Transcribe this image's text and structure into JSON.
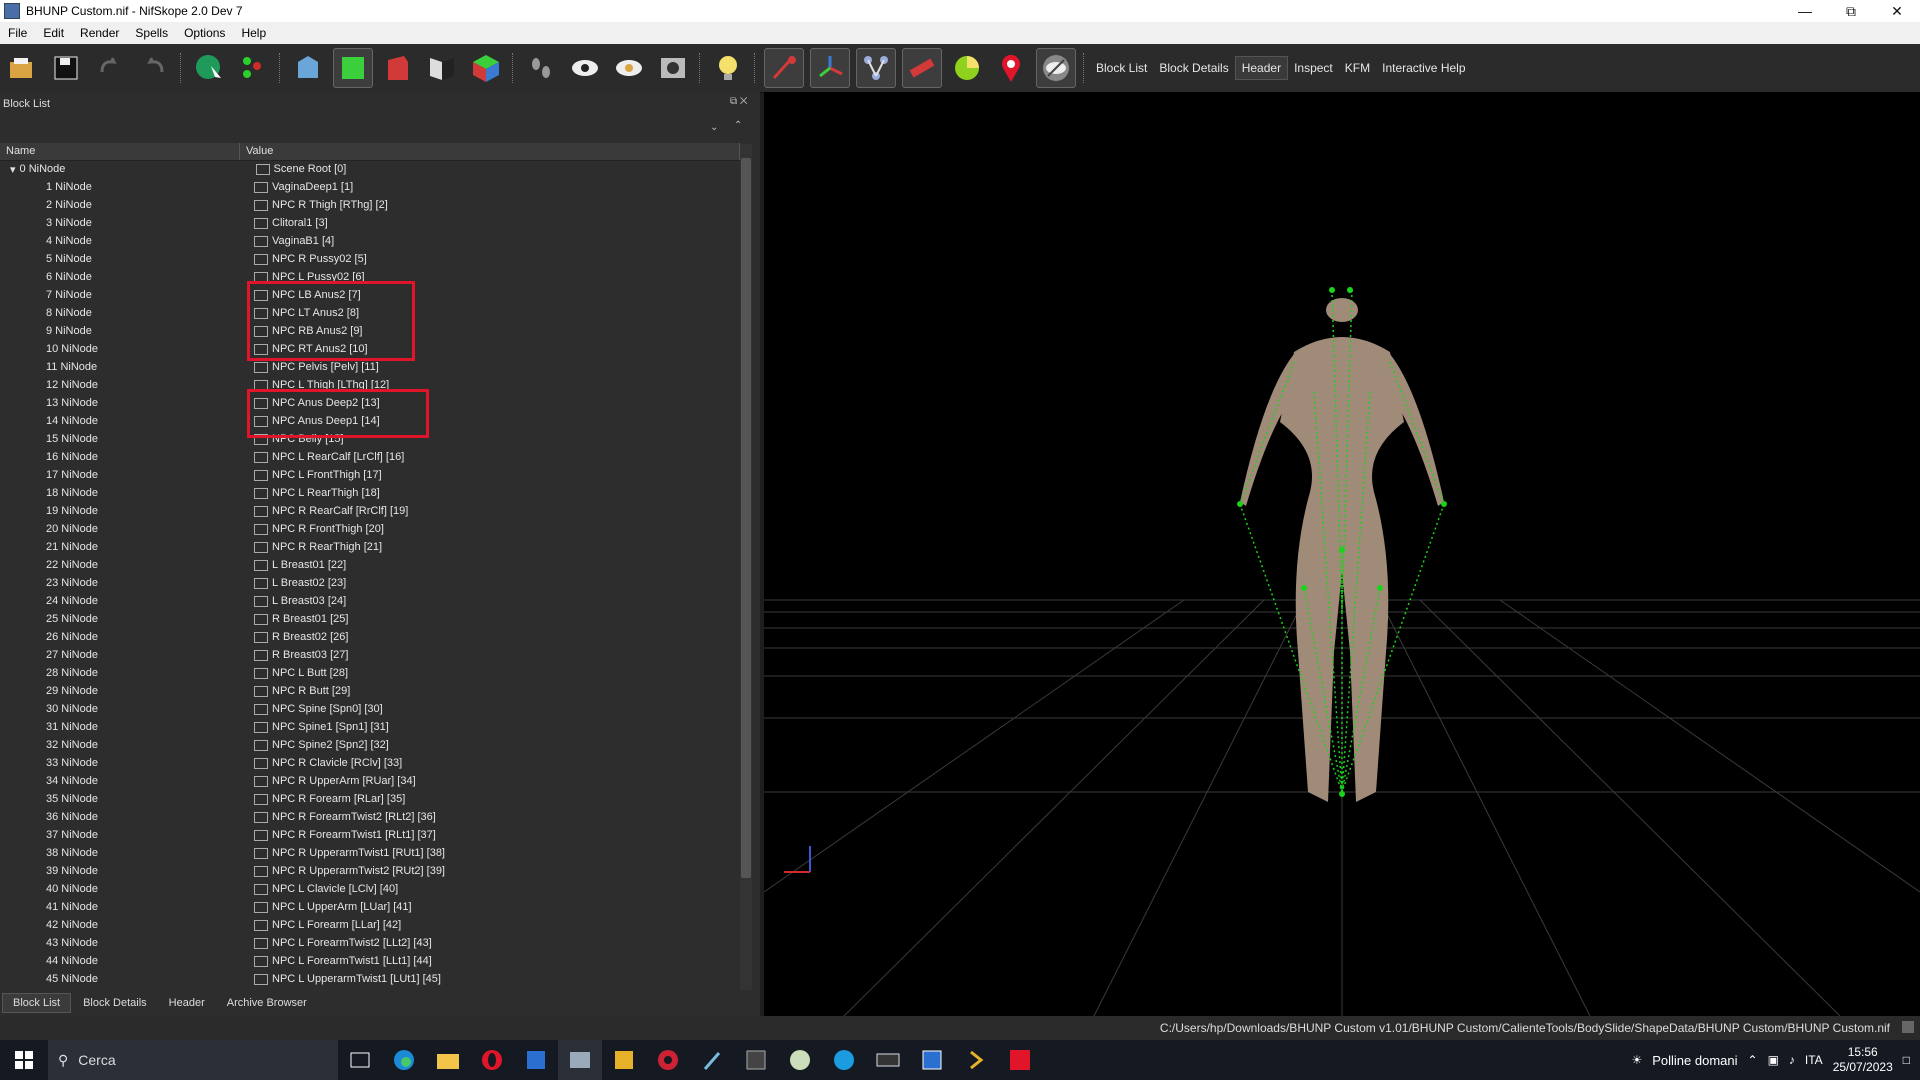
{
  "window": {
    "title": "BHUNP Custom.nif - NifSkope 2.0 Dev 7"
  },
  "menu": [
    "File",
    "Edit",
    "Render",
    "Spells",
    "Options",
    "Help"
  ],
  "toolbar": {
    "text_buttons": [
      "Block List",
      "Block Details",
      "Header",
      "Inspect",
      "KFM",
      "Interactive Help"
    ],
    "active_text_button": "Header"
  },
  "panel": {
    "title": "Block List",
    "columns": {
      "name": "Name",
      "value": "Value"
    },
    "rows": [
      {
        "name": "0 NiNode",
        "value": "Scene Root [0]"
      },
      {
        "name": "1 NiNode",
        "value": "VaginaDeep1 [1]"
      },
      {
        "name": "2 NiNode",
        "value": "NPC R Thigh [RThg] [2]"
      },
      {
        "name": "3 NiNode",
        "value": "Clitoral1 [3]"
      },
      {
        "name": "4 NiNode",
        "value": "VaginaB1 [4]"
      },
      {
        "name": "5 NiNode",
        "value": "NPC R Pussy02 [5]"
      },
      {
        "name": "6 NiNode",
        "value": "NPC L Pussy02 [6]"
      },
      {
        "name": "7 NiNode",
        "value": "NPC LB Anus2 [7]"
      },
      {
        "name": "8 NiNode",
        "value": "NPC LT Anus2 [8]"
      },
      {
        "name": "9 NiNode",
        "value": "NPC RB Anus2 [9]"
      },
      {
        "name": "10 NiNode",
        "value": "NPC RT Anus2 [10]"
      },
      {
        "name": "11 NiNode",
        "value": "NPC Pelvis [Pelv] [11]"
      },
      {
        "name": "12 NiNode",
        "value": "NPC L Thigh [LThg] [12]"
      },
      {
        "name": "13 NiNode",
        "value": "NPC Anus Deep2 [13]"
      },
      {
        "name": "14 NiNode",
        "value": "NPC Anus Deep1 [14]"
      },
      {
        "name": "15 NiNode",
        "value": "NPC Belly [15]"
      },
      {
        "name": "16 NiNode",
        "value": "NPC L RearCalf [LrClf] [16]"
      },
      {
        "name": "17 NiNode",
        "value": "NPC L FrontThigh [17]"
      },
      {
        "name": "18 NiNode",
        "value": "NPC L RearThigh [18]"
      },
      {
        "name": "19 NiNode",
        "value": "NPC R RearCalf [RrClf] [19]"
      },
      {
        "name": "20 NiNode",
        "value": "NPC R FrontThigh [20]"
      },
      {
        "name": "21 NiNode",
        "value": "NPC R RearThigh [21]"
      },
      {
        "name": "22 NiNode",
        "value": "L Breast01 [22]"
      },
      {
        "name": "23 NiNode",
        "value": "L Breast02 [23]"
      },
      {
        "name": "24 NiNode",
        "value": "L Breast03 [24]"
      },
      {
        "name": "25 NiNode",
        "value": "R Breast01 [25]"
      },
      {
        "name": "26 NiNode",
        "value": "R Breast02 [26]"
      },
      {
        "name": "27 NiNode",
        "value": "R Breast03 [27]"
      },
      {
        "name": "28 NiNode",
        "value": "NPC L Butt [28]"
      },
      {
        "name": "29 NiNode",
        "value": "NPC R Butt [29]"
      },
      {
        "name": "30 NiNode",
        "value": "NPC Spine [Spn0] [30]"
      },
      {
        "name": "31 NiNode",
        "value": "NPC Spine1 [Spn1] [31]"
      },
      {
        "name": "32 NiNode",
        "value": "NPC Spine2 [Spn2] [32]"
      },
      {
        "name": "33 NiNode",
        "value": "NPC R Clavicle [RClv] [33]"
      },
      {
        "name": "34 NiNode",
        "value": "NPC R UpperArm [RUar] [34]"
      },
      {
        "name": "35 NiNode",
        "value": "NPC R Forearm [RLar] [35]"
      },
      {
        "name": "36 NiNode",
        "value": "NPC R ForearmTwist2 [RLt2] [36]"
      },
      {
        "name": "37 NiNode",
        "value": "NPC R ForearmTwist1 [RLt1] [37]"
      },
      {
        "name": "38 NiNode",
        "value": "NPC R UpperarmTwist1 [RUt1] [38]"
      },
      {
        "name": "39 NiNode",
        "value": "NPC R UpperarmTwist2 [RUt2] [39]"
      },
      {
        "name": "40 NiNode",
        "value": "NPC L Clavicle [LClv] [40]"
      },
      {
        "name": "41 NiNode",
        "value": "NPC L UpperArm [LUar] [41]"
      },
      {
        "name": "42 NiNode",
        "value": "NPC L Forearm [LLar] [42]"
      },
      {
        "name": "43 NiNode",
        "value": "NPC L ForearmTwist2 [LLt2] [43]"
      },
      {
        "name": "44 NiNode",
        "value": "NPC L ForearmTwist1 [LLt1] [44]"
      },
      {
        "name": "45 NiNode",
        "value": "NPC L UpperarmTwist1 [LUt1] [45]"
      }
    ],
    "tabs": [
      "Block List",
      "Block Details",
      "Header",
      "Archive Browser"
    ],
    "active_tab": "Block List"
  },
  "status": {
    "path": "C:/Users/hp/Downloads/BHUNP Custom v1.01/BHUNP Custom/CalienteTools/BodySlide/ShapeData/BHUNP Custom/BHUNP Custom.nif"
  },
  "taskbar": {
    "search_placeholder": "Cerca",
    "weather": "Polline domani",
    "lang": "ITA",
    "time": "15:56",
    "date": "25/07/2023"
  },
  "colors": {
    "highlight": "#e0152a",
    "skeleton": "#19d419"
  }
}
